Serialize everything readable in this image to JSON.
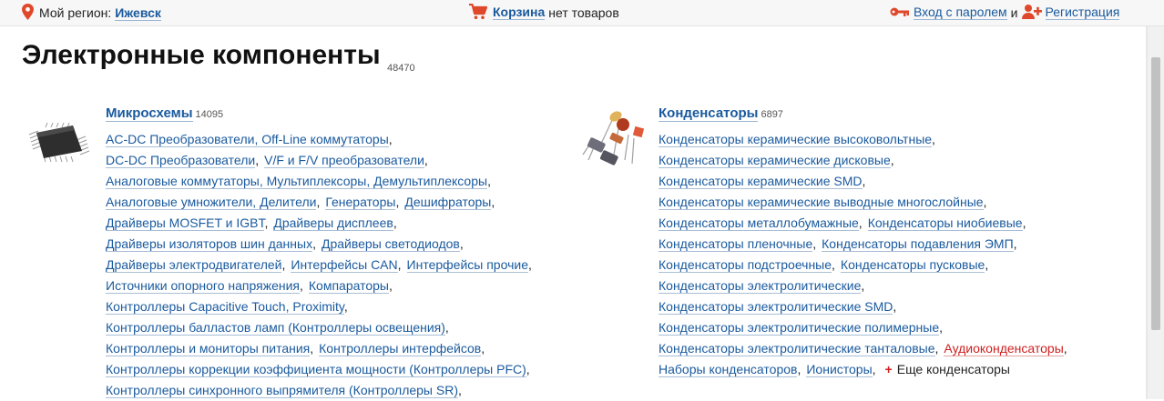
{
  "header": {
    "region_label": "Мой регион:",
    "region_value": "Ижевск",
    "cart_label": "Корзина",
    "cart_status": "нет товаров",
    "login_label": "Вход с паролем",
    "and_text": "и",
    "register_label": "Регистрация"
  },
  "page": {
    "title": "Электронные компоненты",
    "count": "48470"
  },
  "categories": [
    {
      "title": "Микросхемы",
      "count": "14095",
      "lines": [
        [
          "AC-DC Преобразователи, Off-Line коммутаторы"
        ],
        [
          "DC-DC Преобразователи",
          "V/F и F/V преобразователи"
        ],
        [
          "Аналоговые коммутаторы, Мультиплексоры, Демультиплексоры"
        ],
        [
          "Аналоговые умножители, Делители",
          "Генераторы",
          "Дешифраторы"
        ],
        [
          "Драйверы MOSFET и IGBT",
          "Драйверы дисплеев"
        ],
        [
          "Драйверы изоляторов шин данных",
          "Драйверы светодиодов"
        ],
        [
          "Драйверы электродвигателей",
          "Интерфейсы CAN",
          "Интерфейсы прочие"
        ],
        [
          "Источники опорного напряжения",
          "Компараторы"
        ],
        [
          "Контроллеры Capacitive Touch, Proximity"
        ],
        [
          "Контроллеры балластов ламп (Контроллеры освещения)"
        ],
        [
          "Контроллеры и мониторы питания",
          "Контроллеры интерфейсов"
        ],
        [
          "Контроллеры коррекции коэффициента мощности (Контроллеры PFC)"
        ],
        [
          "Контроллеры синхронного выпрямителя (Контроллеры SR)"
        ]
      ]
    },
    {
      "title": "Конденсаторы",
      "count": "6897",
      "lines": [
        [
          "Конденсаторы керамические высоковольтные"
        ],
        [
          "Конденсаторы керамические дисковые"
        ],
        [
          "Конденсаторы керамические SMD"
        ],
        [
          "Конденсаторы керамические выводные многослойные"
        ],
        [
          "Конденсаторы металлобумажные",
          "Конденсаторы ниобиевые"
        ],
        [
          "Конденсаторы пленочные",
          "Конденсаторы подавления ЭМП"
        ],
        [
          "Конденсаторы подстроечные",
          "Конденсаторы пусковые"
        ],
        [
          "Конденсаторы электролитические"
        ],
        [
          "Конденсаторы электролитические SMD"
        ],
        [
          "Конденсаторы электролитические полимерные"
        ],
        [
          "Конденсаторы электролитические танталовые",
          "Аудиоконденсаторы"
        ],
        [
          "Наборы конденсаторов",
          "Ионисторы"
        ]
      ],
      "more_label": "Еще конденсаторы"
    }
  ],
  "colors": {
    "link": "#1a5a9e",
    "accent_red": "#d02020",
    "topbar_bg": "#f7f7f7"
  },
  "icons": [
    "location-pin-icon",
    "cart-icon",
    "key-icon",
    "add-user-icon",
    "plus-icon"
  ]
}
